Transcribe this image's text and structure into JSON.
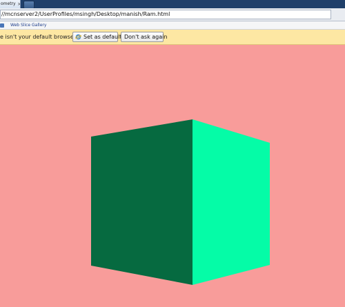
{
  "tab": {
    "title": "ometry",
    "close_glyph": "×"
  },
  "address": {
    "url": "//mcnserver2/UserProfiles/msingh/Desktop/manish/Ram.html"
  },
  "favorites": {
    "items": [
      {
        "label": "Web Slice Gallery",
        "icon": "web-slice-icon"
      }
    ]
  },
  "notification": {
    "message": "e isn't your default browser.",
    "set_default_label": "Set as default",
    "dont_ask_label": "Don't ask again"
  },
  "scene": {
    "background_color": "#f89c9a",
    "cube_left_face_color": "#066a40",
    "cube_right_face_color": "#05fca7"
  }
}
